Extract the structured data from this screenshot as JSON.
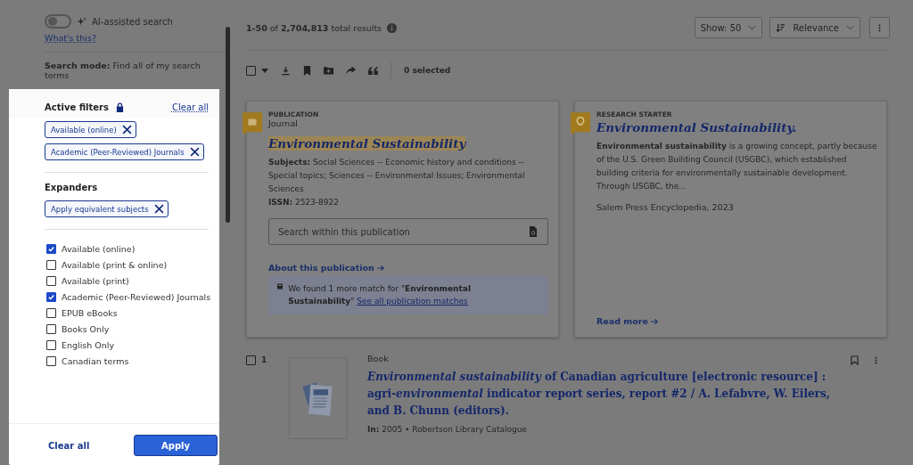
{
  "sidebar": {
    "ai_toggle": {
      "label": "AI-assisted search",
      "on": false
    },
    "help_link": "What's this?",
    "search_mode": {
      "label": "Search mode:",
      "value": "Find all of my search terms"
    }
  },
  "filter_panel": {
    "title": "Active filters",
    "clear_all_link": "Clear all",
    "active_filters": [
      "Available (online)",
      "Academic (Peer-Reviewed) Journals"
    ],
    "expanders_title": "Expanders",
    "expanders": [
      "Apply equivalent subjects"
    ],
    "options": [
      {
        "label": "Available (online)",
        "checked": true
      },
      {
        "label": "Available (print & online)",
        "checked": false
      },
      {
        "label": "Available (print)",
        "checked": false
      },
      {
        "label": "Academic (Peer-Reviewed) Journals",
        "checked": true
      },
      {
        "label": "EPUB eBooks",
        "checked": false
      },
      {
        "label": "Books Only",
        "checked": false
      },
      {
        "label": "English Only",
        "checked": false
      },
      {
        "label": "Canadian terms",
        "checked": false
      }
    ],
    "clear_button": "Clear all",
    "apply_button": "Apply"
  },
  "results_header": {
    "summary": "**1-50** of **2,704,813** total results",
    "show": "Show: 50",
    "sort": "Relevance",
    "selected_count": "0 selected",
    "select_all_checked": false
  },
  "cards": [
    {
      "kind": "publication",
      "type_label": "PUBLICATION",
      "subtype": "Journal",
      "title": "Environmental Sustainability",
      "subjects_label": "Subjects:",
      "subjects": "Social Sciences -- Economic history and conditions -- Special topics; Sciences -- Environmental Issues; Environmental Sciences",
      "issn_label": "ISSN:",
      "issn": "2523-8922",
      "search_placeholder": "Search within this publication",
      "about_link": "About this publication",
      "notice": "We found 1 more match for \"**Environmental Sustainability**\"",
      "notice_link": "See all publication matches"
    },
    {
      "kind": "research_starter",
      "type_label": "RESEARCH STARTER",
      "title": "*Environmental Sustainability*.",
      "summary": "**Environmental sustainability** is a growing concept, partly because of the U.S. Green Building Council (USGBC), which established building criteria for environmentally sustainable development. Through USGBC, the...",
      "source": "Salem Press Encyclopedia, 2023",
      "read_more": "Read more"
    }
  ],
  "results": [
    {
      "number": "1",
      "checked": false,
      "type": "Book",
      "title": "*Environmental* *sustainability* of Canadian agriculture [electronic resource] : agri-*environmental* indicator report series, report #2 / A. Lefabvre, W. Eilers, and B. Chunn (editors).",
      "meta_label": "In:",
      "meta": "2005 • Robertson Library Catalogue"
    }
  ]
}
